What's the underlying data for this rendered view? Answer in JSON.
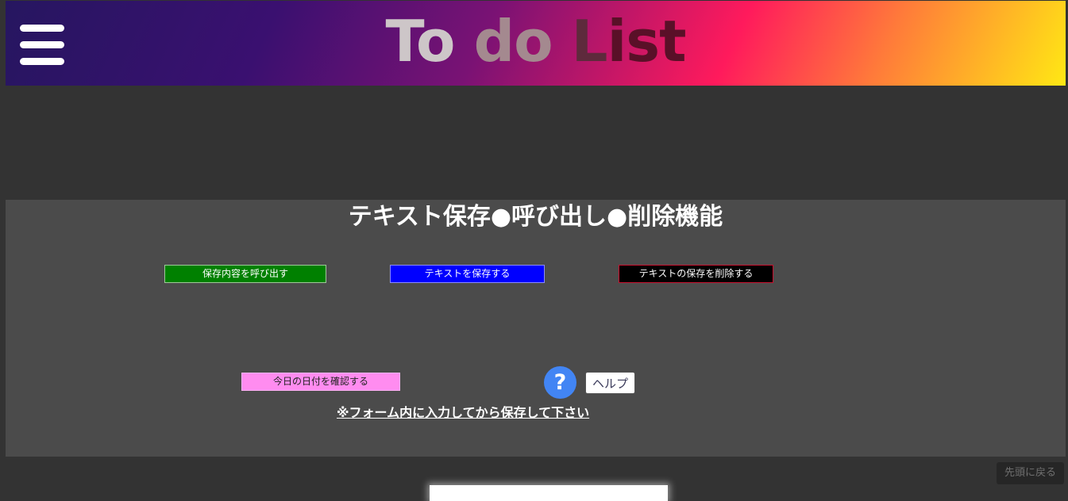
{
  "header": {
    "menu_icon": "hamburger-menu-icon",
    "title_word_1": "To",
    "title_word_2": "do",
    "title_word_3a": "L",
    "title_word_3b": "ist",
    "gradient_colors": [
      "#261660",
      "#3a1070",
      "#7a1274",
      "#ff1a5c",
      "#ff7a3a",
      "#ffe814"
    ]
  },
  "panel": {
    "heading": "テキスト保存●呼び出し●削除機能",
    "buttons": {
      "load": "保存内容を呼び出す",
      "save": "テキストを保存する",
      "delete": "テキストの保存を削除する",
      "date": "今日の日付を確認する"
    },
    "help_icon_glyph": "?",
    "help_label": "ヘルプ",
    "note": "※フォーム内に入力してから保存して下さい"
  },
  "back_to_top": "先頭に戻る",
  "colors": {
    "page_background": "#333333",
    "panel_background": "#4b4b4b",
    "load_button": "#008000",
    "save_button": "#0000ff",
    "delete_button": "#000000",
    "date_button": "#ff8cf0",
    "help_circle": "#4285f4"
  }
}
